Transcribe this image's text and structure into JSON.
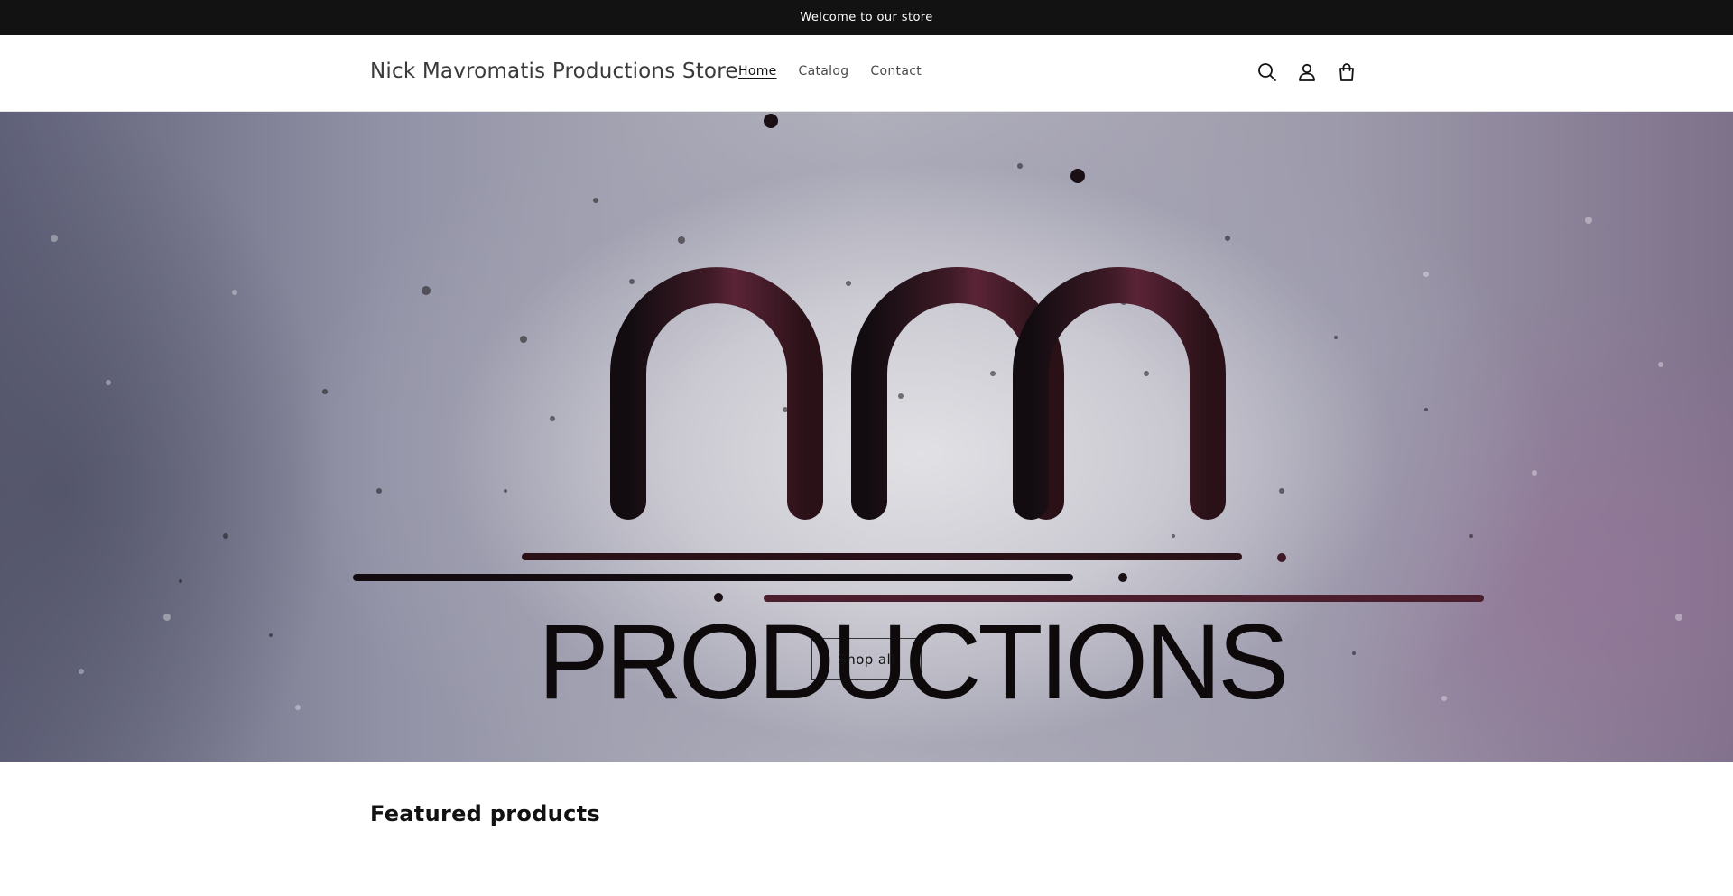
{
  "announcement": {
    "text": "Welcome to our store"
  },
  "header": {
    "store_name": "Nick Mavromatis Productions Store",
    "nav": [
      {
        "label": "Home",
        "active": true
      },
      {
        "label": "Catalog",
        "active": false
      },
      {
        "label": "Contact",
        "active": false
      }
    ],
    "icons": [
      "search-icon",
      "account-icon",
      "cart-icon"
    ]
  },
  "hero": {
    "logo_text": "PRODUCTIONS",
    "button_label": "Shop all",
    "colors": {
      "logo_dark": "#120c10",
      "logo_accent": "#5a2436"
    }
  },
  "featured": {
    "title": "Featured products"
  }
}
